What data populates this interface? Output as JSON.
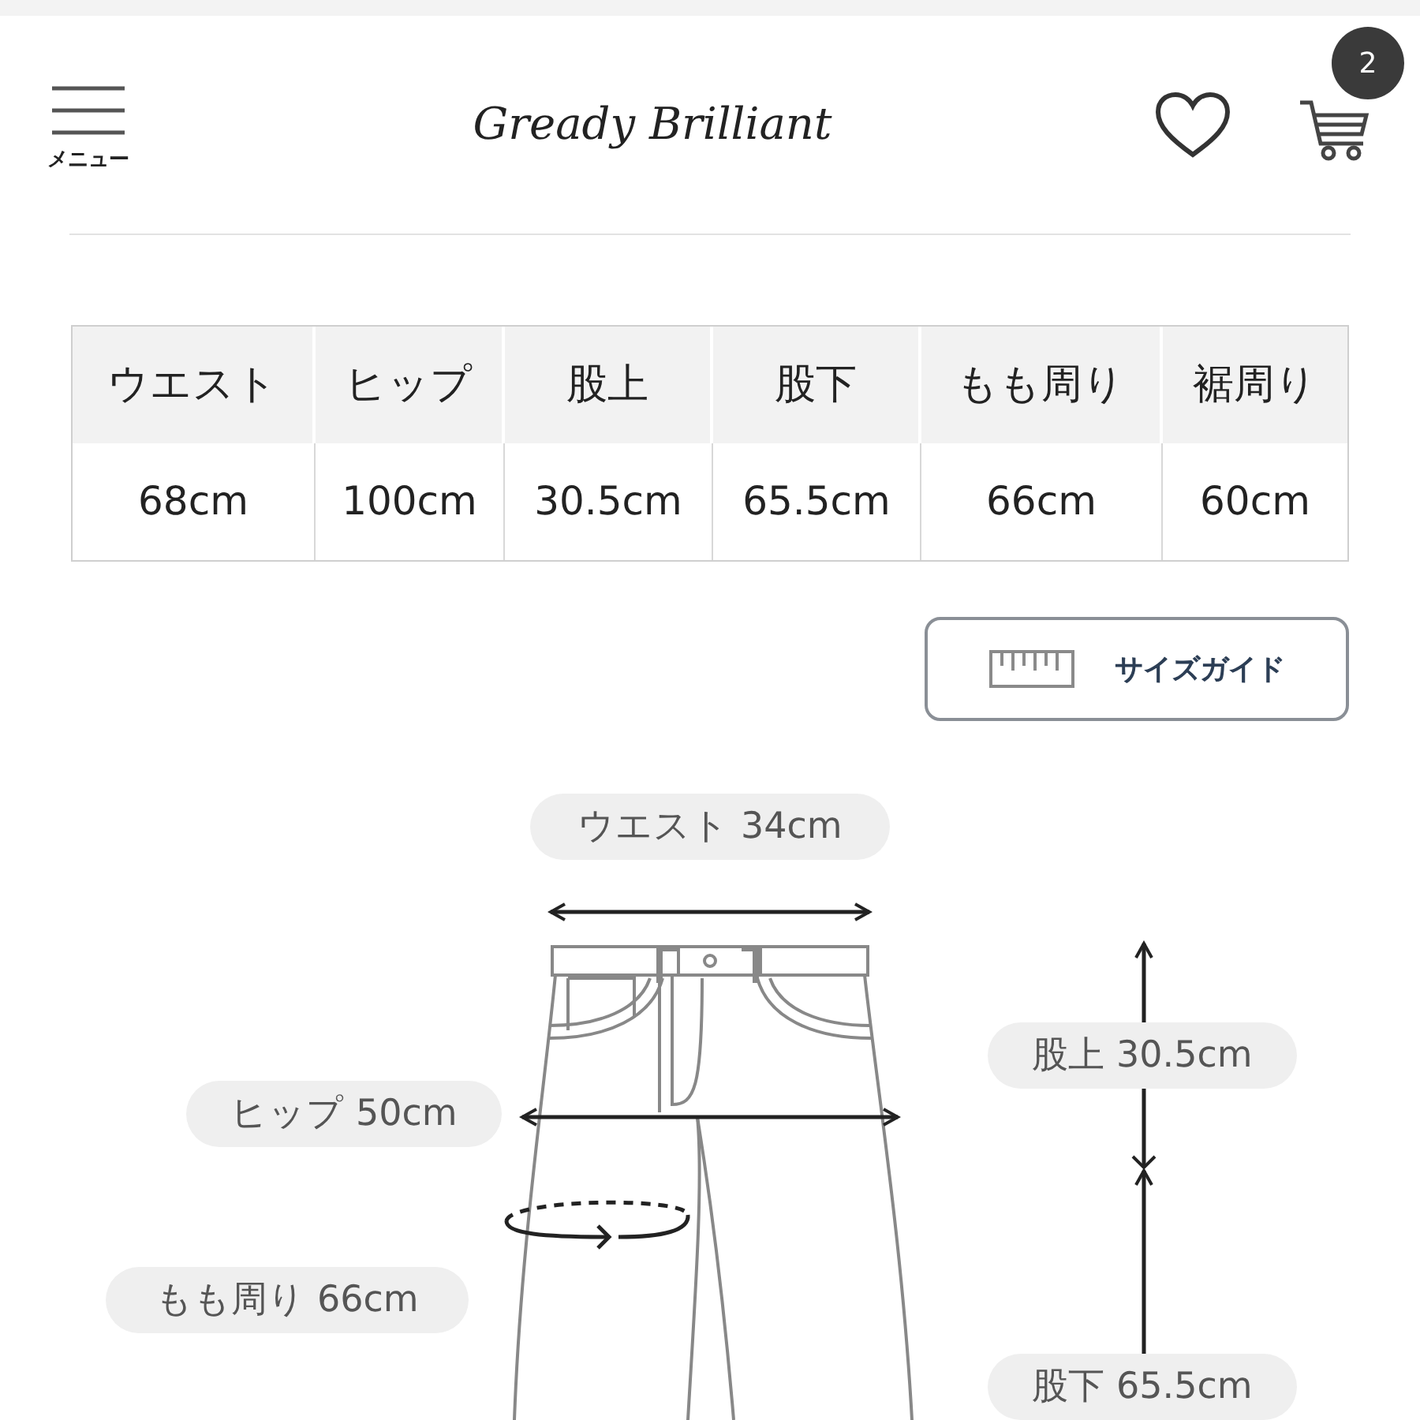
{
  "header": {
    "menu_label": "メニュー",
    "logo": "Gready Brilliant",
    "cart_count": "2"
  },
  "size_table": {
    "columns": [
      "ウエスト",
      "ヒップ",
      "股上",
      "股下",
      "もも周り",
      "裾周り"
    ],
    "rows": [
      [
        "68cm",
        "100cm",
        "30.5cm",
        "65.5cm",
        "66cm",
        "60cm"
      ]
    ]
  },
  "size_guide_button": {
    "label": "サイズガイド"
  },
  "diagram": {
    "labels": [
      {
        "kind": "waist",
        "text": "ウエスト 34cm"
      },
      {
        "kind": "rise",
        "text": "股上 30.5cm"
      },
      {
        "kind": "hip",
        "text": "ヒップ 50cm"
      },
      {
        "kind": "thigh",
        "text": "もも周り 66cm"
      },
      {
        "kind": "inseam",
        "text": "股下 65.5cm"
      }
    ]
  }
}
